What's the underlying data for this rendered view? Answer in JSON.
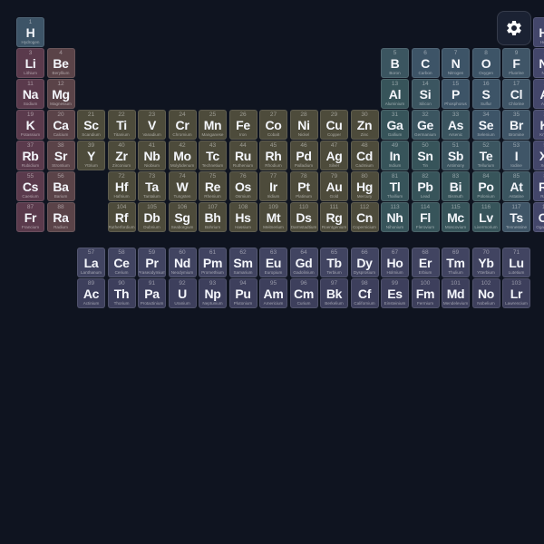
{
  "category_colors": {
    "nonmetal": "#3d5467",
    "alkali": "#5a3a4c",
    "alkaline": "#5a4348",
    "transition": "#4d4b3b",
    "post": "#37545a",
    "metalloid": "#3b5560",
    "halogen": "#3f5567",
    "noble": "#43466a",
    "lanth": "#414461",
    "actin": "#3d3f5c"
  },
  "settings": {
    "icon": "gear-icon"
  },
  "elements": [
    {
      "n": "1",
      "s": "H",
      "name": "Hydrogen",
      "col": 1,
      "row": 1,
      "cat": "nonmetal"
    },
    {
      "n": "2",
      "s": "He",
      "name": "Helium",
      "col": 18,
      "row": 1,
      "cat": "noble"
    },
    {
      "n": "3",
      "s": "Li",
      "name": "Lithium",
      "col": 1,
      "row": 2,
      "cat": "alkali"
    },
    {
      "n": "4",
      "s": "Be",
      "name": "Beryllium",
      "col": 2,
      "row": 2,
      "cat": "alkaline"
    },
    {
      "n": "5",
      "s": "B",
      "name": "Boron",
      "col": 13,
      "row": 2,
      "cat": "metalloid"
    },
    {
      "n": "6",
      "s": "C",
      "name": "Carbon",
      "col": 14,
      "row": 2,
      "cat": "nonmetal"
    },
    {
      "n": "7",
      "s": "N",
      "name": "Nitrogen",
      "col": 15,
      "row": 2,
      "cat": "nonmetal"
    },
    {
      "n": "8",
      "s": "O",
      "name": "Oxygen",
      "col": 16,
      "row": 2,
      "cat": "nonmetal"
    },
    {
      "n": "9",
      "s": "F",
      "name": "Fluorine",
      "col": 17,
      "row": 2,
      "cat": "halogen"
    },
    {
      "n": "10",
      "s": "Ne",
      "name": "Neon",
      "col": 18,
      "row": 2,
      "cat": "noble"
    },
    {
      "n": "11",
      "s": "Na",
      "name": "Sodium",
      "col": 1,
      "row": 3,
      "cat": "alkali"
    },
    {
      "n": "12",
      "s": "Mg",
      "name": "Magnesium",
      "col": 2,
      "row": 3,
      "cat": "alkaline"
    },
    {
      "n": "13",
      "s": "Al",
      "name": "Aluminium",
      "col": 13,
      "row": 3,
      "cat": "post"
    },
    {
      "n": "14",
      "s": "Si",
      "name": "Silicon",
      "col": 14,
      "row": 3,
      "cat": "metalloid"
    },
    {
      "n": "15",
      "s": "P",
      "name": "Phosphorus",
      "col": 15,
      "row": 3,
      "cat": "nonmetal"
    },
    {
      "n": "16",
      "s": "S",
      "name": "Sulfur",
      "col": 16,
      "row": 3,
      "cat": "nonmetal"
    },
    {
      "n": "17",
      "s": "Cl",
      "name": "Chlorine",
      "col": 17,
      "row": 3,
      "cat": "halogen"
    },
    {
      "n": "18",
      "s": "Ar",
      "name": "Argon",
      "col": 18,
      "row": 3,
      "cat": "noble"
    },
    {
      "n": "19",
      "s": "K",
      "name": "Potassium",
      "col": 1,
      "row": 4,
      "cat": "alkali"
    },
    {
      "n": "20",
      "s": "Ca",
      "name": "Calcium",
      "col": 2,
      "row": 4,
      "cat": "alkaline"
    },
    {
      "n": "21",
      "s": "Sc",
      "name": "Scandium",
      "col": 3,
      "row": 4,
      "cat": "transition"
    },
    {
      "n": "22",
      "s": "Ti",
      "name": "Titanium",
      "col": 4,
      "row": 4,
      "cat": "transition"
    },
    {
      "n": "23",
      "s": "V",
      "name": "Vanadium",
      "col": 5,
      "row": 4,
      "cat": "transition"
    },
    {
      "n": "24",
      "s": "Cr",
      "name": "Chromium",
      "col": 6,
      "row": 4,
      "cat": "transition"
    },
    {
      "n": "25",
      "s": "Mn",
      "name": "Manganese",
      "col": 7,
      "row": 4,
      "cat": "transition"
    },
    {
      "n": "26",
      "s": "Fe",
      "name": "Iron",
      "col": 8,
      "row": 4,
      "cat": "transition"
    },
    {
      "n": "27",
      "s": "Co",
      "name": "Cobalt",
      "col": 9,
      "row": 4,
      "cat": "transition"
    },
    {
      "n": "28",
      "s": "Ni",
      "name": "Nickel",
      "col": 10,
      "row": 4,
      "cat": "transition"
    },
    {
      "n": "29",
      "s": "Cu",
      "name": "Copper",
      "col": 11,
      "row": 4,
      "cat": "transition"
    },
    {
      "n": "30",
      "s": "Zn",
      "name": "Zinc",
      "col": 12,
      "row": 4,
      "cat": "transition"
    },
    {
      "n": "31",
      "s": "Ga",
      "name": "Gallium",
      "col": 13,
      "row": 4,
      "cat": "post"
    },
    {
      "n": "32",
      "s": "Ge",
      "name": "Germanium",
      "col": 14,
      "row": 4,
      "cat": "metalloid"
    },
    {
      "n": "33",
      "s": "As",
      "name": "Arsenic",
      "col": 15,
      "row": 4,
      "cat": "metalloid"
    },
    {
      "n": "34",
      "s": "Se",
      "name": "Selenium",
      "col": 16,
      "row": 4,
      "cat": "nonmetal"
    },
    {
      "n": "35",
      "s": "Br",
      "name": "Bromine",
      "col": 17,
      "row": 4,
      "cat": "halogen"
    },
    {
      "n": "36",
      "s": "Kr",
      "name": "Krypton",
      "col": 18,
      "row": 4,
      "cat": "noble"
    },
    {
      "n": "37",
      "s": "Rb",
      "name": "Rubidium",
      "col": 1,
      "row": 5,
      "cat": "alkali"
    },
    {
      "n": "38",
      "s": "Sr",
      "name": "Strontium",
      "col": 2,
      "row": 5,
      "cat": "alkaline"
    },
    {
      "n": "39",
      "s": "Y",
      "name": "Yttrium",
      "col": 3,
      "row": 5,
      "cat": "transition"
    },
    {
      "n": "40",
      "s": "Zr",
      "name": "Zirconium",
      "col": 4,
      "row": 5,
      "cat": "transition"
    },
    {
      "n": "41",
      "s": "Nb",
      "name": "Niobium",
      "col": 5,
      "row": 5,
      "cat": "transition"
    },
    {
      "n": "42",
      "s": "Mo",
      "name": "Molybdenum",
      "col": 6,
      "row": 5,
      "cat": "transition"
    },
    {
      "n": "43",
      "s": "Tc",
      "name": "Technetium",
      "col": 7,
      "row": 5,
      "cat": "transition"
    },
    {
      "n": "44",
      "s": "Ru",
      "name": "Ruthenium",
      "col": 8,
      "row": 5,
      "cat": "transition"
    },
    {
      "n": "45",
      "s": "Rh",
      "name": "Rhodium",
      "col": 9,
      "row": 5,
      "cat": "transition"
    },
    {
      "n": "46",
      "s": "Pd",
      "name": "Palladium",
      "col": 10,
      "row": 5,
      "cat": "transition"
    },
    {
      "n": "47",
      "s": "Ag",
      "name": "Silver",
      "col": 11,
      "row": 5,
      "cat": "transition"
    },
    {
      "n": "48",
      "s": "Cd",
      "name": "Cadmium",
      "col": 12,
      "row": 5,
      "cat": "transition"
    },
    {
      "n": "49",
      "s": "In",
      "name": "Indium",
      "col": 13,
      "row": 5,
      "cat": "post"
    },
    {
      "n": "50",
      "s": "Sn",
      "name": "Tin",
      "col": 14,
      "row": 5,
      "cat": "post"
    },
    {
      "n": "51",
      "s": "Sb",
      "name": "Antimony",
      "col": 15,
      "row": 5,
      "cat": "metalloid"
    },
    {
      "n": "52",
      "s": "Te",
      "name": "Tellurium",
      "col": 16,
      "row": 5,
      "cat": "metalloid"
    },
    {
      "n": "53",
      "s": "I",
      "name": "Iodine",
      "col": 17,
      "row": 5,
      "cat": "halogen"
    },
    {
      "n": "54",
      "s": "Xe",
      "name": "Xenon",
      "col": 18,
      "row": 5,
      "cat": "noble"
    },
    {
      "n": "55",
      "s": "Cs",
      "name": "Caesium",
      "col": 1,
      "row": 6,
      "cat": "alkali"
    },
    {
      "n": "56",
      "s": "Ba",
      "name": "Barium",
      "col": 2,
      "row": 6,
      "cat": "alkaline"
    },
    {
      "n": "72",
      "s": "Hf",
      "name": "Hafnium",
      "col": 4,
      "row": 6,
      "cat": "transition"
    },
    {
      "n": "73",
      "s": "Ta",
      "name": "Tantalum",
      "col": 5,
      "row": 6,
      "cat": "transition"
    },
    {
      "n": "74",
      "s": "W",
      "name": "Tungsten",
      "col": 6,
      "row": 6,
      "cat": "transition"
    },
    {
      "n": "75",
      "s": "Re",
      "name": "Rhenium",
      "col": 7,
      "row": 6,
      "cat": "transition"
    },
    {
      "n": "76",
      "s": "Os",
      "name": "Osmium",
      "col": 8,
      "row": 6,
      "cat": "transition"
    },
    {
      "n": "77",
      "s": "Ir",
      "name": "Iridium",
      "col": 9,
      "row": 6,
      "cat": "transition"
    },
    {
      "n": "78",
      "s": "Pt",
      "name": "Platinum",
      "col": 10,
      "row": 6,
      "cat": "transition"
    },
    {
      "n": "79",
      "s": "Au",
      "name": "Gold",
      "col": 11,
      "row": 6,
      "cat": "transition"
    },
    {
      "n": "80",
      "s": "Hg",
      "name": "Mercury",
      "col": 12,
      "row": 6,
      "cat": "transition"
    },
    {
      "n": "81",
      "s": "Tl",
      "name": "Thallium",
      "col": 13,
      "row": 6,
      "cat": "post"
    },
    {
      "n": "82",
      "s": "Pb",
      "name": "Lead",
      "col": 14,
      "row": 6,
      "cat": "post"
    },
    {
      "n": "83",
      "s": "Bi",
      "name": "Bismuth",
      "col": 15,
      "row": 6,
      "cat": "post"
    },
    {
      "n": "84",
      "s": "Po",
      "name": "Polonium",
      "col": 16,
      "row": 6,
      "cat": "post"
    },
    {
      "n": "85",
      "s": "At",
      "name": "Astatine",
      "col": 17,
      "row": 6,
      "cat": "metalloid"
    },
    {
      "n": "86",
      "s": "Rn",
      "name": "Radon",
      "col": 18,
      "row": 6,
      "cat": "noble"
    },
    {
      "n": "87",
      "s": "Fr",
      "name": "Francium",
      "col": 1,
      "row": 7,
      "cat": "alkali"
    },
    {
      "n": "88",
      "s": "Ra",
      "name": "Radium",
      "col": 2,
      "row": 7,
      "cat": "alkaline"
    },
    {
      "n": "104",
      "s": "Rf",
      "name": "Rutherfordium",
      "col": 4,
      "row": 7,
      "cat": "transition"
    },
    {
      "n": "105",
      "s": "Db",
      "name": "Dubnium",
      "col": 5,
      "row": 7,
      "cat": "transition"
    },
    {
      "n": "106",
      "s": "Sg",
      "name": "Seaborgium",
      "col": 6,
      "row": 7,
      "cat": "transition"
    },
    {
      "n": "107",
      "s": "Bh",
      "name": "Bohrium",
      "col": 7,
      "row": 7,
      "cat": "transition"
    },
    {
      "n": "108",
      "s": "Hs",
      "name": "Hassium",
      "col": 8,
      "row": 7,
      "cat": "transition"
    },
    {
      "n": "109",
      "s": "Mt",
      "name": "Meitnerium",
      "col": 9,
      "row": 7,
      "cat": "transition"
    },
    {
      "n": "110",
      "s": "Ds",
      "name": "Darmstadtium",
      "col": 10,
      "row": 7,
      "cat": "transition"
    },
    {
      "n": "111",
      "s": "Rg",
      "name": "Roentgenium",
      "col": 11,
      "row": 7,
      "cat": "transition"
    },
    {
      "n": "112",
      "s": "Cn",
      "name": "Copernicium",
      "col": 12,
      "row": 7,
      "cat": "transition"
    },
    {
      "n": "113",
      "s": "Nh",
      "name": "Nihonium",
      "col": 13,
      "row": 7,
      "cat": "post"
    },
    {
      "n": "114",
      "s": "Fl",
      "name": "Flerovium",
      "col": 14,
      "row": 7,
      "cat": "post"
    },
    {
      "n": "115",
      "s": "Mc",
      "name": "Moscovium",
      "col": 15,
      "row": 7,
      "cat": "post"
    },
    {
      "n": "116",
      "s": "Lv",
      "name": "Livermorium",
      "col": 16,
      "row": 7,
      "cat": "post"
    },
    {
      "n": "117",
      "s": "Ts",
      "name": "Tennessine",
      "col": 17,
      "row": 7,
      "cat": "halogen"
    },
    {
      "n": "118",
      "s": "Og",
      "name": "Oganesson",
      "col": 18,
      "row": 7,
      "cat": "noble"
    },
    {
      "n": "57",
      "s": "La",
      "name": "Lanthanum",
      "col": 3,
      "row": 8,
      "cat": "lanth"
    },
    {
      "n": "58",
      "s": "Ce",
      "name": "Cerium",
      "col": 4,
      "row": 8,
      "cat": "lanth"
    },
    {
      "n": "59",
      "s": "Pr",
      "name": "Praseodymium",
      "col": 5,
      "row": 8,
      "cat": "lanth"
    },
    {
      "n": "60",
      "s": "Nd",
      "name": "Neodymium",
      "col": 6,
      "row": 8,
      "cat": "lanth"
    },
    {
      "n": "61",
      "s": "Pm",
      "name": "Promethium",
      "col": 7,
      "row": 8,
      "cat": "lanth"
    },
    {
      "n": "62",
      "s": "Sm",
      "name": "Samarium",
      "col": 8,
      "row": 8,
      "cat": "lanth"
    },
    {
      "n": "63",
      "s": "Eu",
      "name": "Europium",
      "col": 9,
      "row": 8,
      "cat": "lanth"
    },
    {
      "n": "64",
      "s": "Gd",
      "name": "Gadolinium",
      "col": 10,
      "row": 8,
      "cat": "lanth"
    },
    {
      "n": "65",
      "s": "Tb",
      "name": "Terbium",
      "col": 11,
      "row": 8,
      "cat": "lanth"
    },
    {
      "n": "66",
      "s": "Dy",
      "name": "Dysprosium",
      "col": 12,
      "row": 8,
      "cat": "lanth"
    },
    {
      "n": "67",
      "s": "Ho",
      "name": "Holmium",
      "col": 13,
      "row": 8,
      "cat": "lanth"
    },
    {
      "n": "68",
      "s": "Er",
      "name": "Erbium",
      "col": 14,
      "row": 8,
      "cat": "lanth"
    },
    {
      "n": "69",
      "s": "Tm",
      "name": "Thulium",
      "col": 15,
      "row": 8,
      "cat": "lanth"
    },
    {
      "n": "70",
      "s": "Yb",
      "name": "Ytterbium",
      "col": 16,
      "row": 8,
      "cat": "lanth"
    },
    {
      "n": "71",
      "s": "Lu",
      "name": "Lutetium",
      "col": 17,
      "row": 8,
      "cat": "lanth"
    },
    {
      "n": "89",
      "s": "Ac",
      "name": "Actinium",
      "col": 3,
      "row": 9,
      "cat": "actin"
    },
    {
      "n": "90",
      "s": "Th",
      "name": "Thorium",
      "col": 4,
      "row": 9,
      "cat": "actin"
    },
    {
      "n": "91",
      "s": "Pa",
      "name": "Protactinium",
      "col": 5,
      "row": 9,
      "cat": "actin"
    },
    {
      "n": "92",
      "s": "U",
      "name": "Uranium",
      "col": 6,
      "row": 9,
      "cat": "actin"
    },
    {
      "n": "93",
      "s": "Np",
      "name": "Neptunium",
      "col": 7,
      "row": 9,
      "cat": "actin"
    },
    {
      "n": "94",
      "s": "Pu",
      "name": "Plutonium",
      "col": 8,
      "row": 9,
      "cat": "actin"
    },
    {
      "n": "95",
      "s": "Am",
      "name": "Americium",
      "col": 9,
      "row": 9,
      "cat": "actin"
    },
    {
      "n": "96",
      "s": "Cm",
      "name": "Curium",
      "col": 10,
      "row": 9,
      "cat": "actin"
    },
    {
      "n": "97",
      "s": "Bk",
      "name": "Berkelium",
      "col": 11,
      "row": 9,
      "cat": "actin"
    },
    {
      "n": "98",
      "s": "Cf",
      "name": "Californium",
      "col": 12,
      "row": 9,
      "cat": "actin"
    },
    {
      "n": "99",
      "s": "Es",
      "name": "Einsteinium",
      "col": 13,
      "row": 9,
      "cat": "actin"
    },
    {
      "n": "100",
      "s": "Fm",
      "name": "Fermium",
      "col": 14,
      "row": 9,
      "cat": "actin"
    },
    {
      "n": "101",
      "s": "Md",
      "name": "Mendelevium",
      "col": 15,
      "row": 9,
      "cat": "actin"
    },
    {
      "n": "102",
      "s": "No",
      "name": "Nobelium",
      "col": 16,
      "row": 9,
      "cat": "actin"
    },
    {
      "n": "103",
      "s": "Lr",
      "name": "Lawrencium",
      "col": 17,
      "row": 9,
      "cat": "actin"
    }
  ]
}
